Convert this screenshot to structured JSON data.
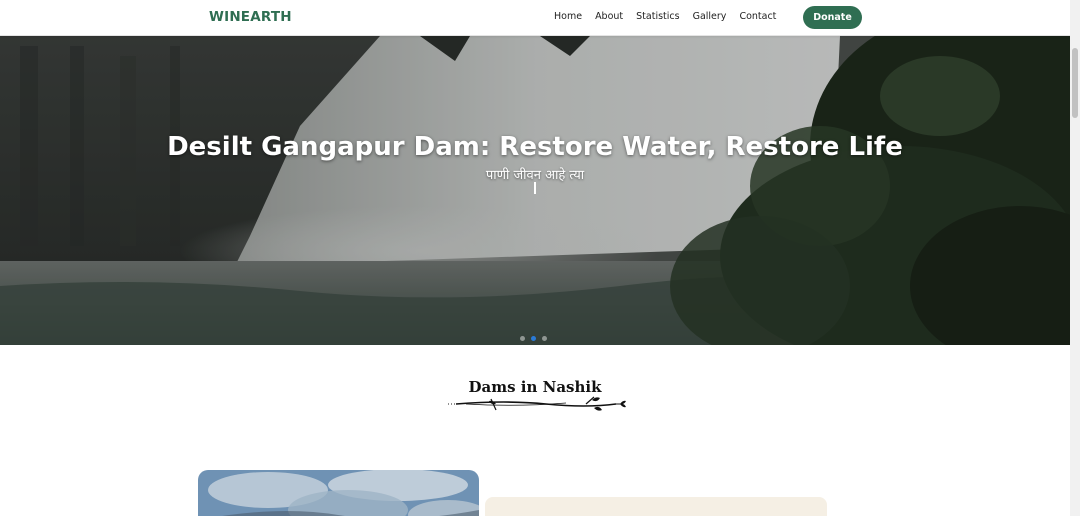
{
  "nav": {
    "brand": "WINEARTH",
    "links": [
      "Home",
      "About",
      "Statistics",
      "Gallery",
      "Contact"
    ],
    "donate_label": "Donate",
    "brand_color": "#2f6e52"
  },
  "hero": {
    "title": "Desilt Gangapur Dam: Restore Water, Restore Life",
    "subtitle": "पाणी जीवन आहे त्या"
  },
  "section": {
    "title": "Dams in Nashik"
  },
  "colors": {
    "accent": "#2f6e52",
    "card_panel": "#f5efe4",
    "active_dot": "#2a7ad6"
  }
}
